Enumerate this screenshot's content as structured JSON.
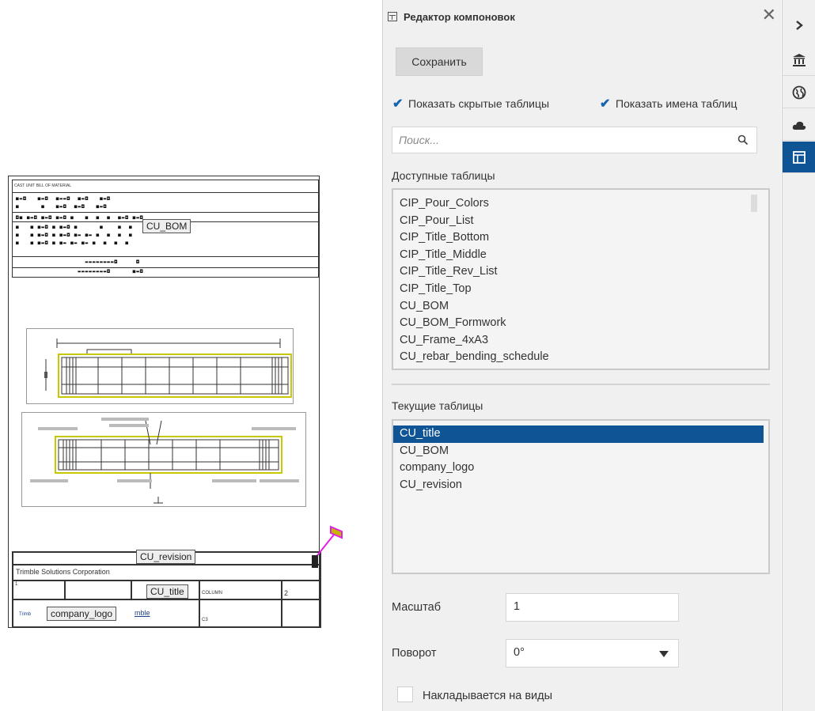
{
  "drawing": {
    "bom_header": "CAST UNIT BILL OF MATERIAL",
    "labels": {
      "cu_bom": "CU_BOM",
      "cu_revision": "CU_revision",
      "cu_title": "CU_title",
      "company_logo": "company_logo"
    },
    "title_block": {
      "company": "Trimble Solutions Corporation",
      "cell_1": "1",
      "cell_column": "COLUMN",
      "cell_2": "2",
      "cell_c3": "C3",
      "logo_prefix": "Trimb",
      "logo_suffix": "mble"
    }
  },
  "panel": {
    "title": "Редактор компоновок",
    "save_label": "Сохранить",
    "show_hidden_label": "Показать скрытые таблицы",
    "show_names_label": "Показать имена таблиц",
    "show_hidden_checked": true,
    "show_names_checked": true,
    "search_placeholder": "Поиск...",
    "available_label": "Доступные таблицы",
    "available_tables": [
      "CIP_Pour_Colors",
      "CIP_Pour_List",
      "CIP_Title_Bottom",
      "CIP_Title_Middle",
      "CIP_Title_Rev_List",
      "CIP_Title_Top",
      "CU_BOM",
      "CU_BOM_Formwork",
      "CU_Frame_4xA3",
      "CU_rebar_bending_schedule"
    ],
    "current_label": "Текущие таблицы",
    "current_tables": [
      "CU_title",
      "CU_BOM",
      "company_logo",
      "CU_revision"
    ],
    "selected_current": "CU_title",
    "scale_label": "Масштаб",
    "scale_value": "1",
    "rotation_label": "Поворот",
    "rotation_value": "0°",
    "overlay_label": "Накладывается на виды",
    "overlay_checked": false
  },
  "strip": {
    "icons": [
      "chevron-right-icon",
      "bank-icon",
      "globe-icon",
      "cloud-icon",
      "layout-editor-icon"
    ],
    "active": "layout-editor-icon",
    "accent": "#0f5596"
  }
}
